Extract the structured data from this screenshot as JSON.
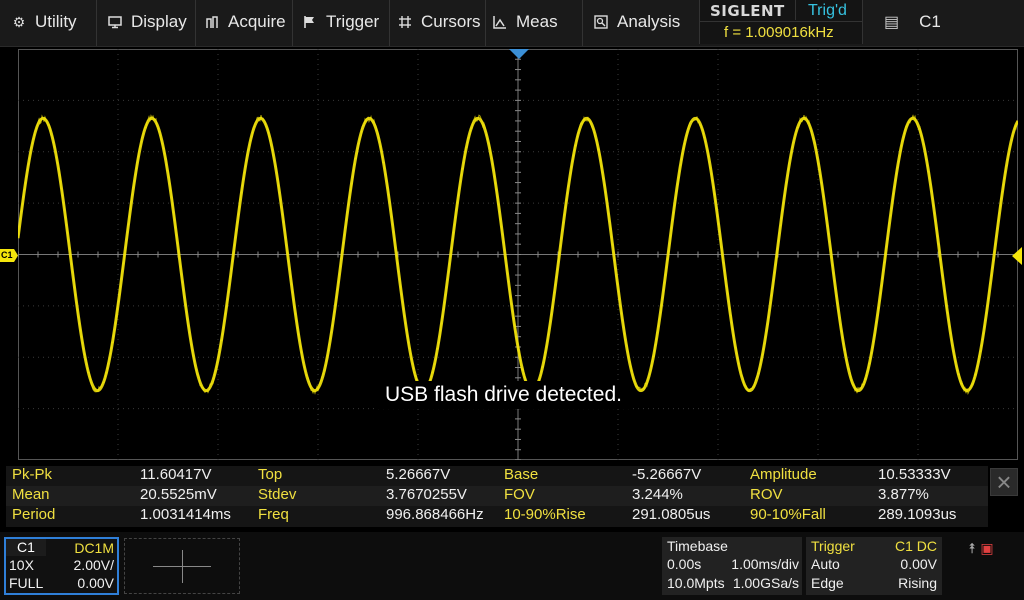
{
  "menu": {
    "items": [
      {
        "label": "Utility",
        "icon": "gear-icon"
      },
      {
        "label": "Display",
        "icon": "monitor-icon"
      },
      {
        "label": "Acquire",
        "icon": "acquire-icon"
      },
      {
        "label": "Trigger",
        "icon": "flag-icon"
      },
      {
        "label": "Cursors",
        "icon": "cursor-grid-icon"
      },
      {
        "label": "Meas",
        "icon": "measure-icon"
      },
      {
        "label": "Analysis",
        "icon": "analysis-icon"
      }
    ]
  },
  "brand": {
    "name": "SIGLENT",
    "trigger_status": "Trig'd",
    "frequency": "f = 1.009016kHz"
  },
  "active_channel": {
    "label": "C1",
    "icon": "clipboard-icon"
  },
  "waveform": {
    "channel": "C1",
    "color": "#f5e60c",
    "cycles_on_screen": 9.2,
    "amplitude_divisions": 2.65
  },
  "markers": {
    "channel_label": "C1"
  },
  "message": "USB flash drive detected.",
  "measurements": {
    "rows": [
      [
        {
          "label": "Pk-Pk",
          "value": "11.60417V"
        },
        {
          "label": "Top",
          "value": "5.26667V"
        },
        {
          "label": "Base",
          "value": "-5.26667V"
        },
        {
          "label": "Amplitude",
          "value": "10.53333V"
        }
      ],
      [
        {
          "label": "Mean",
          "value": "20.5525mV"
        },
        {
          "label": "Stdev",
          "value": "3.7670255V"
        },
        {
          "label": "FOV",
          "value": "3.244%"
        },
        {
          "label": "ROV",
          "value": "3.877%"
        }
      ],
      [
        {
          "label": "Period",
          "value": "1.0031414ms"
        },
        {
          "label": "Freq",
          "value": "996.868466Hz"
        },
        {
          "label": "10-90%Rise",
          "value": "291.0805us"
        },
        {
          "label": "90-10%Fall",
          "value": "289.1093us"
        }
      ]
    ]
  },
  "channel1": {
    "name": "C1",
    "coupling": "DC1M",
    "probe": "10X",
    "scale": "2.00V/",
    "bandwidth": "FULL",
    "offset": "0.00V"
  },
  "timebase": {
    "title": "Timebase",
    "delay": "0.00s",
    "scale": "1.00ms/div",
    "memory": "10.0Mpts",
    "sample_rate": "1.00GSa/s"
  },
  "trigger": {
    "title": "Trigger",
    "source": "C1 DC",
    "mode": "Auto",
    "level": "0.00V",
    "type": "Edge",
    "slope": "Rising"
  },
  "status": {
    "usb_icon": "usb-icon",
    "network_icon": "network-icon"
  }
}
